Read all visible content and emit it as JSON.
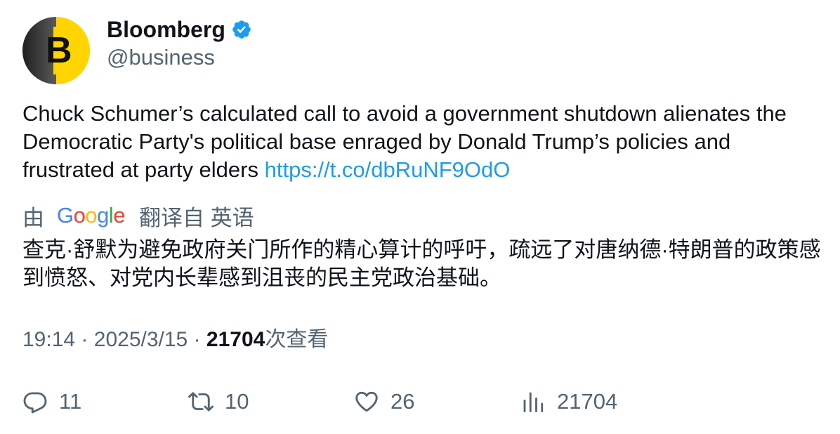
{
  "author": {
    "avatar_letter": "B",
    "name": "Bloomberg",
    "handle": "@business",
    "verified": true
  },
  "tweet": {
    "text": "Chuck Schumer’s calculated call to avoid a government shutdown alienates the Democratic Party's political base enraged by Donald Trump’s policies and frustrated at party elders ",
    "link": "https://t.co/dbRuNF9OdO"
  },
  "translation": {
    "prefix": "由",
    "provider": "Google",
    "suffix": "翻译自 英语",
    "text": "查克·舒默为避免政府关门所作的精心算计的呼吁，疏远了对唐纳德·特朗普的政策感到愤怒、对党内长辈感到沮丧的民主党政治基础。"
  },
  "meta": {
    "time": "19:14",
    "separator": "·",
    "date": "2025/3/15",
    "views_count": "21704",
    "views_label": "次查看"
  },
  "actions": {
    "replies": "11",
    "retweets": "10",
    "likes": "26",
    "views": "21704"
  },
  "colors": {
    "accent": "#1d9bf0",
    "muted": "#536471",
    "text": "#0f1419",
    "avatar_bg": "#ffd400"
  }
}
